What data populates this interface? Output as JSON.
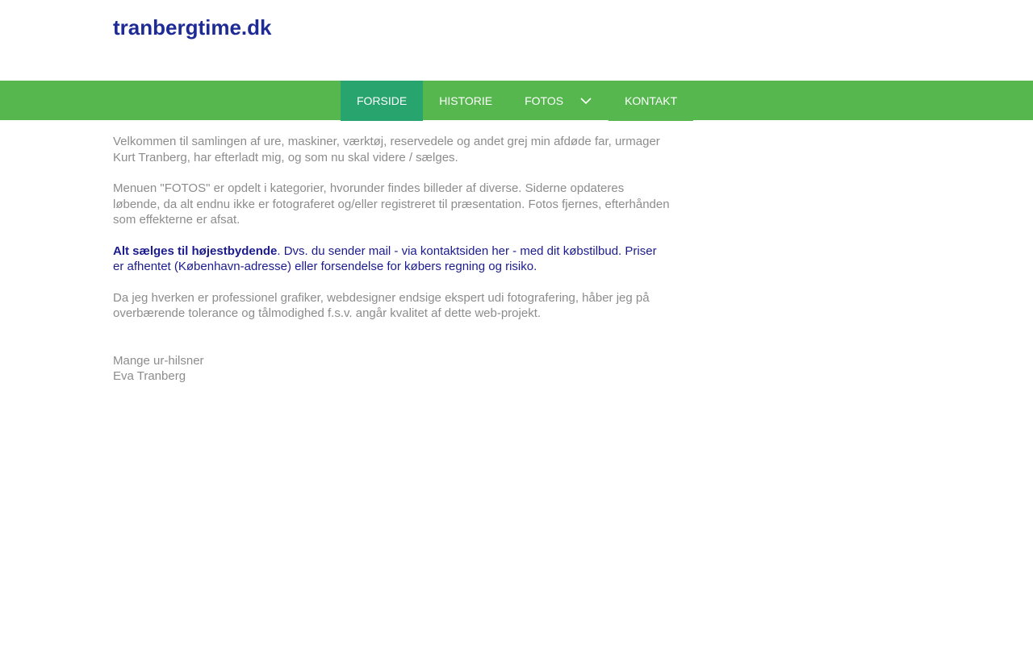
{
  "header": {
    "site_title": "tranbergtime.dk"
  },
  "nav": {
    "items": [
      {
        "label": "FORSIDE"
      },
      {
        "label": "HISTORIE"
      },
      {
        "label": "FOTOS"
      },
      {
        "label": "KONTAKT"
      }
    ],
    "active": "FORSIDE"
  },
  "main": {
    "paragraph_1": "Velkommen til samlingen af ure, maskiner, værktøj, reservedele og andet grej min afdøde far, urmager Kurt Tranberg, har efterladt mig, og som nu skal videre / sælges.",
    "paragraph_2": "Menuen \"FOTOS\" er opdelt i kategorier, hvorunder findes billeder af diverse. Siderne opdateres løbende, da alt endnu ikke er fotograferet og/eller registreret til præsentation. Fotos fjernes, efterhånden som effekterne er afsat.",
    "highlight_bold": "Alt sælges til højestbydende",
    "highlight_rest": ". Dvs. du sender mail - via kontaktsiden her - med dit købstilbud. Priser er afhentet (København-adresse) eller forsendelse for købers regning og risiko.",
    "paragraph_4": "Da jeg hverken er professionel grafiker, webdesigner endsige ekspert udi fotografering, håber jeg på overbærende tolerance og tålmodighed f.s.v. angår kvalitet af dette web-projekt.",
    "signoff_line_1": "Mange ur-hilsner",
    "signoff_line_2": "Eva Tranberg"
  },
  "colors": {
    "title": "#1f2b95",
    "nav_bar": "#56b74e",
    "nav_active": "#28a56e",
    "body_text": "#8c8c8c",
    "highlight_text": "#1b1b8e"
  }
}
